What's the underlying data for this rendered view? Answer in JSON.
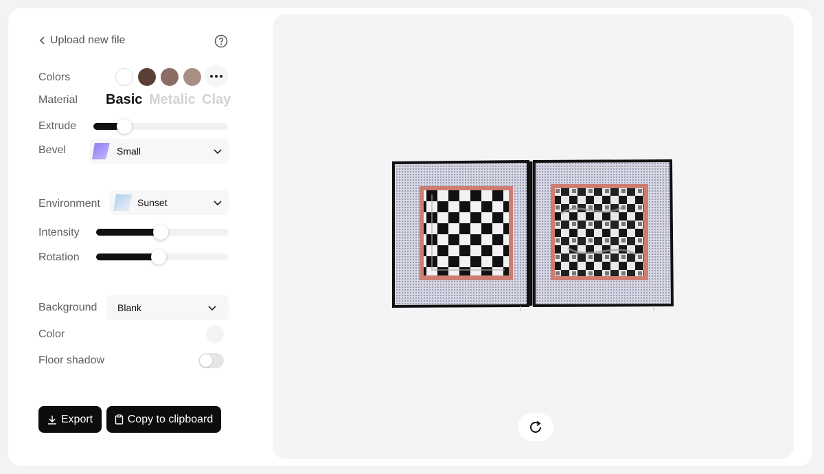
{
  "upload_link": "Upload new file",
  "colors": {
    "label": "Colors",
    "swatches": [
      "#ffffff",
      "#5a3f35",
      "#8c6d64",
      "#a98f86"
    ]
  },
  "material": {
    "label": "Material",
    "options": [
      "Basic",
      "Metalic",
      "Clay"
    ],
    "selected": "Basic"
  },
  "extrude": {
    "label": "Extrude",
    "value_fraction": 0.23
  },
  "bevel": {
    "label": "Bevel",
    "value": "Small"
  },
  "environment": {
    "label": "Environment",
    "value": "Sunset"
  },
  "intensity": {
    "label": "Intensity",
    "value_fraction": 0.49
  },
  "rotation": {
    "label": "Rotation",
    "value_fraction": 0.47
  },
  "background": {
    "label": "Background",
    "value": "Blank"
  },
  "color": {
    "label": "Color",
    "value": "#f4f4f6"
  },
  "floor_shadow": {
    "label": "Floor shadow",
    "enabled": false
  },
  "buttons": {
    "export": "Export",
    "copy": "Copy to clipboard"
  },
  "accent": "#0d0d0d",
  "icons": [
    "chevron-left-icon",
    "help-icon",
    "more-icon",
    "chevron-down-icon",
    "download-icon",
    "clipboard-icon",
    "refresh-icon"
  ]
}
